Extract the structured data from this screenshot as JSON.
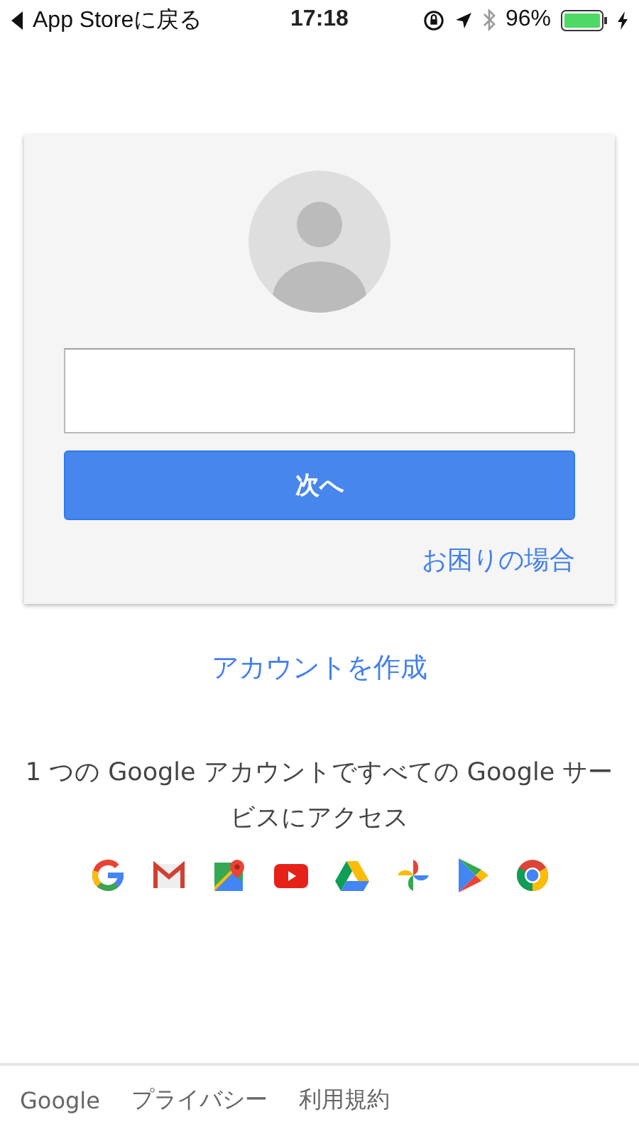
{
  "status_bar": {
    "back_label": "App Storeに戻る",
    "time": "17:18",
    "battery": "96%"
  },
  "card": {
    "next_button": "次へ",
    "help_link": "お困りの場合"
  },
  "create_account_link": "アカウントを作成",
  "tagline": "1 つの Google アカウントですべての Google サービスにアクセス",
  "services": [
    {
      "kind": "google"
    },
    {
      "kind": "gmail"
    },
    {
      "kind": "maps"
    },
    {
      "kind": "youtube"
    },
    {
      "kind": "drive"
    },
    {
      "kind": "photos"
    },
    {
      "kind": "play"
    },
    {
      "kind": "chrome"
    }
  ],
  "footer_links": [
    "Google",
    "プライバシー",
    "利用規約"
  ]
}
